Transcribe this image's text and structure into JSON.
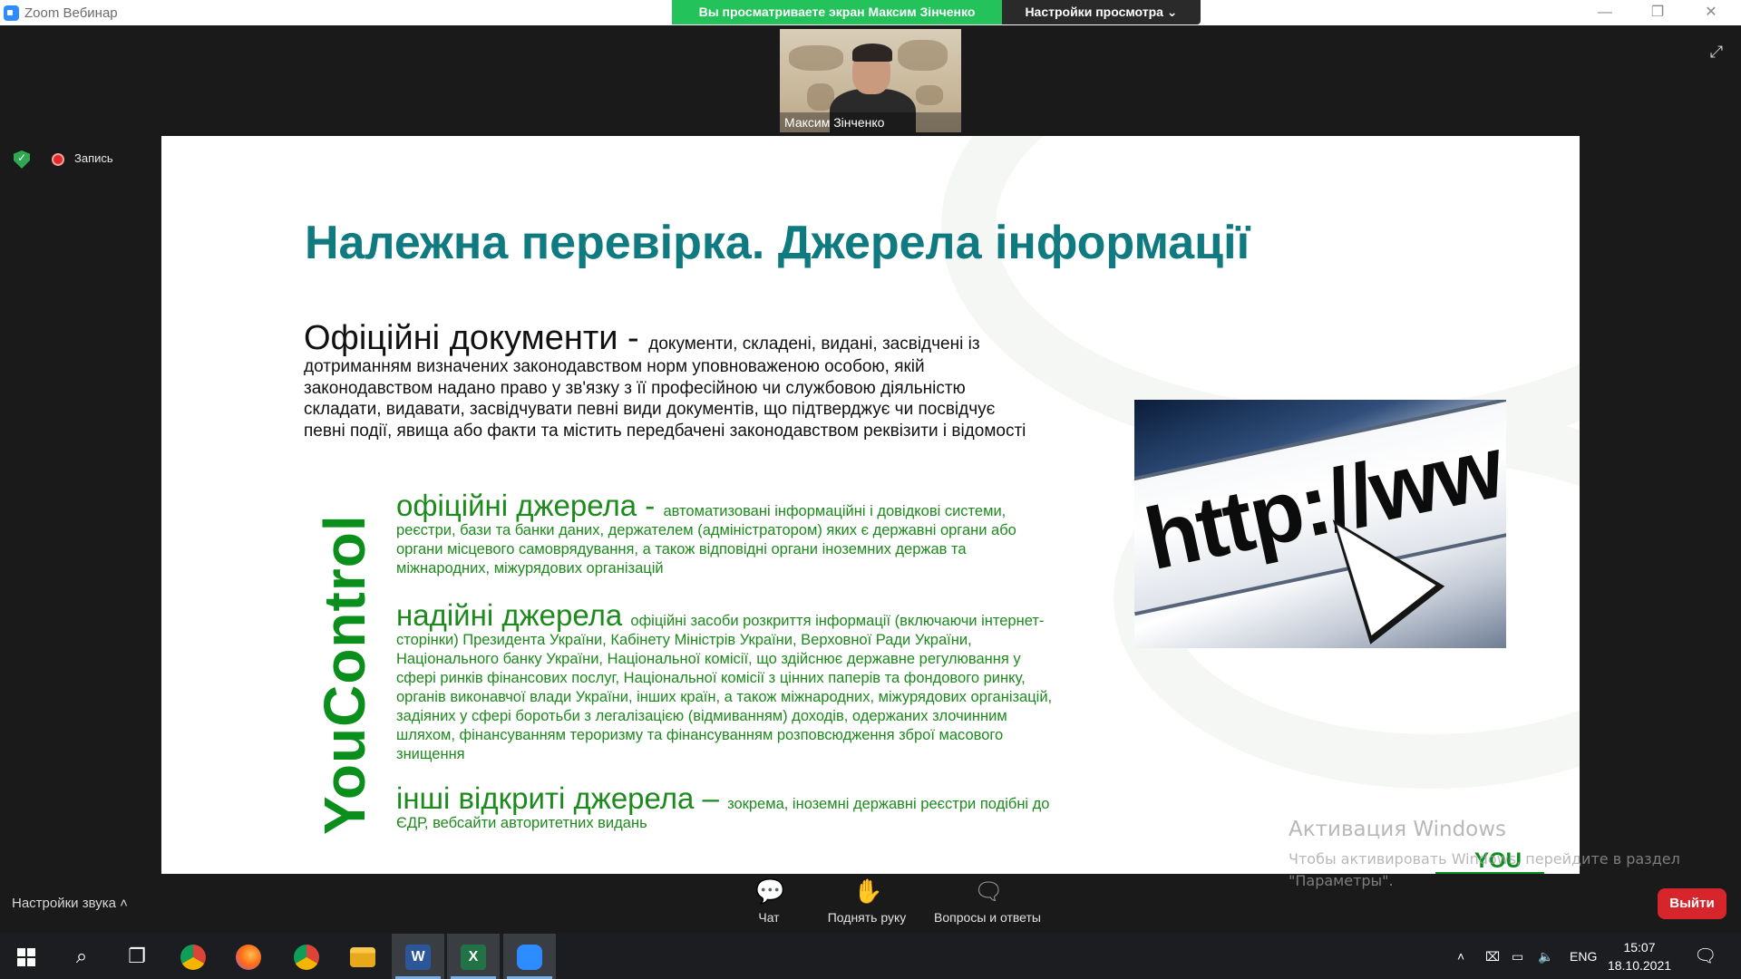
{
  "window": {
    "title": "Zoom Вебинар",
    "controls": [
      "—",
      "❐",
      "✕"
    ]
  },
  "share_banner": {
    "viewing_text": "Вы просматриваете экран Максим Зінченко",
    "view_options_label": "Настройки просмотра ⌄"
  },
  "video": {
    "participant_name": "Максим Зінченко"
  },
  "status": {
    "recording_label": "Запись"
  },
  "slide": {
    "title": "Належна перевірка. Джерела інформації",
    "official_docs_lead": "Офіційні документи - ",
    "official_docs_body": "документи, складені, видані, засвідчені із дотриманням визначених законодавством норм уповноваженою особою, якій законодавством надано право у зв'язку з її професійною чи службовою діяльністю складати, видавати, засвідчувати певні види документів, що підтверджує чи посвідчує певні події, явища або факти та містить передбачені законодавством реквізити і відомості",
    "brand_vertical": "YouControl",
    "sources": [
      {
        "head": "офіційні джерела - ",
        "body": "автоматизовані інформаційні і довідкові системи, реєстри, бази та банки даних, держателем (адміністратором) яких є державні органи або органи місцевого самоврядування, а також відповідні органи іноземних держав та міжнародних, міжурядових організацій"
      },
      {
        "head": "надійні джерела ",
        "body": "офіційні засоби розкриття інформації (включаючи інтернет-сторінки) Президента України, Кабінету Міністрів України, Верховної Ради України, Національного банку України, Національної комісії, що здійснює державне регулювання у сфері ринків фінансових послуг, Національної комісії з цінних паперів та фондового ринку, органів виконавчої влади України, інших країн, а також міжнародних, міжурядових організацій, задіяних у сфері боротьби з легалізацією (відмиванням) доходів, одержаних злочинним шляхом, фінансуванням тероризму та фінансуванням розповсюдження зброї масового знищення"
      },
      {
        "head": "інші відкриті джерела – ",
        "body": "зокрема, іноземні державні реєстри подібні до ЄДР, вебсайти авторитетних видань"
      }
    ],
    "image_text": "http://ww",
    "corner_logo": "YOU"
  },
  "activation": {
    "title": "Активация Windows",
    "line1": "Чтобы активировать Windows, перейдите в раздел",
    "line2": "\"Параметры\"."
  },
  "controls": {
    "audio_settings": "Настройки звука  ˄",
    "chat": "Чат",
    "raise_hand": "Поднять руку",
    "qa": "Вопросы и ответы",
    "leave": "Выйти"
  },
  "taskbar": {
    "language": "ENG",
    "time": "15:07",
    "date": "18.10.2021"
  },
  "colors": {
    "share_green": "#23c25a",
    "title_teal": "#0f7a80",
    "brand_green": "#0a8f1c",
    "leave_red": "#d6252b"
  }
}
